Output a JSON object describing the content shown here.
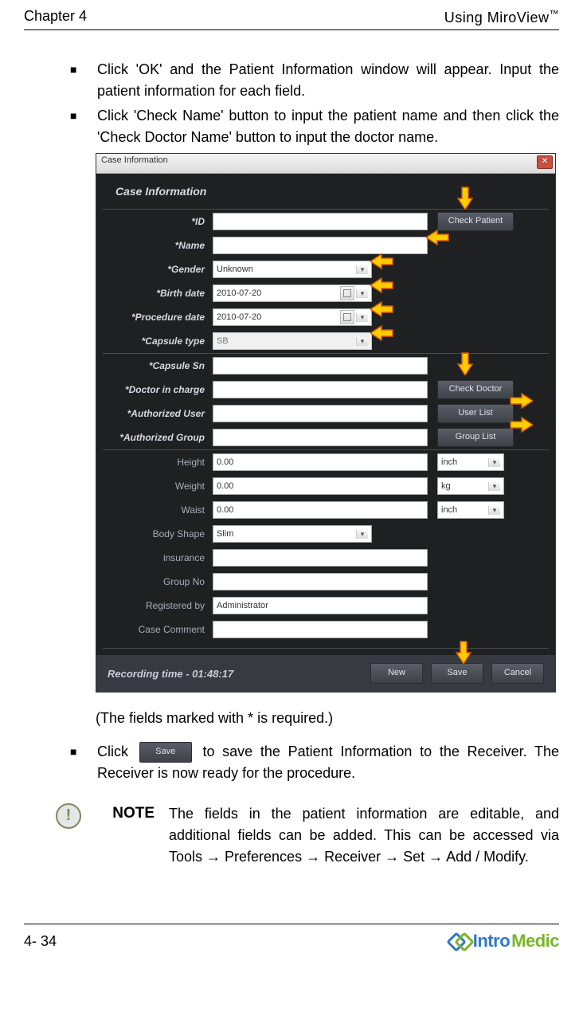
{
  "header": {
    "left": "Chapter 4",
    "right": "Using MiroView",
    "tm": "™"
  },
  "bullets": [
    "Click 'OK' and the Patient Information window will appear.   Input the patient information for each field.",
    "Click 'Check Name' button to input the patient name and then click the 'Check Doctor Name' button to input the doctor name."
  ],
  "screenshot": {
    "titlebar": "Case Information",
    "dialog_title": "Case Information",
    "footer_text": "Recording time - 01:48:17",
    "footer_buttons": {
      "new": "New",
      "save": "Save",
      "cancel": "Cancel"
    },
    "fields": {
      "id": {
        "label": "*ID",
        "value": "",
        "required": true,
        "button": "Check Patient"
      },
      "name": {
        "label": "*Name",
        "value": "",
        "required": true
      },
      "gender": {
        "label": "*Gender",
        "value": "Unknown",
        "required": true
      },
      "birth": {
        "label": "*Birth date",
        "value": "2010-07-20",
        "required": true
      },
      "proc": {
        "label": "*Procedure date",
        "value": "2010-07-20",
        "required": true
      },
      "capsule_t": {
        "label": "*Capsule type",
        "value": "SB",
        "required": true
      },
      "capsule_sn": {
        "label": "*Capsule Sn",
        "value": "",
        "required": true
      },
      "doctor": {
        "label": "*Doctor in charge",
        "value": "",
        "required": true,
        "button": "Check Doctor"
      },
      "auth_user": {
        "label": "*Authorized User",
        "value": "",
        "required": true,
        "button": "User List"
      },
      "auth_group": {
        "label": "*Authorized Group",
        "value": "",
        "required": true,
        "button": "Group List"
      },
      "height": {
        "label": "Height",
        "value": "0.00",
        "unit": "inch"
      },
      "weight": {
        "label": "Weight",
        "value": "0.00",
        "unit": "kg"
      },
      "waist": {
        "label": "Waist",
        "value": "0.00",
        "unit": "inch"
      },
      "body": {
        "label": "Body Shape",
        "value": "Slim"
      },
      "insurance": {
        "label": "insurance",
        "value": ""
      },
      "groupno": {
        "label": "Group No",
        "value": ""
      },
      "regby": {
        "label": "Registered by",
        "value": "Administrator"
      },
      "comment": {
        "label": "Case Comment",
        "value": ""
      }
    }
  },
  "caption": "(The fields marked with * is required.)",
  "bullet3_pre": "Click",
  "bullet3_btn": "Save",
  "bullet3_post": " to save the Patient Information to the Receiver. The Receiver is now ready for the procedure.",
  "note": {
    "label": "NOTE",
    "body": "The fields in the patient information are editable, and additional fields can be added. This can be accessed via Tools  → Preferences → Receiver → Set → Add / Modify."
  },
  "footer": {
    "page": "4- 34",
    "logo1": "Intro",
    "logo2": "Medic"
  }
}
